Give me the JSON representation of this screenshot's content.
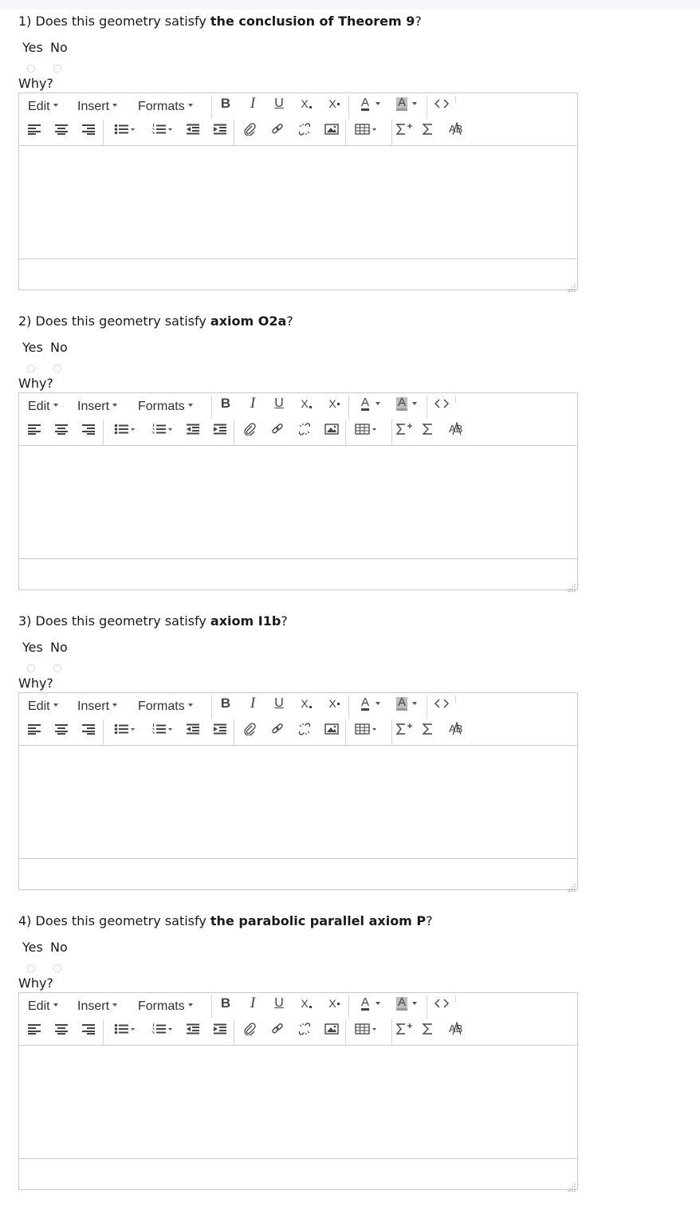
{
  "questions": [
    {
      "num": "1) ",
      "pre": "Does this geometry satisfy ",
      "bold": "the conclusion of Theorem 9",
      "post": "?"
    },
    {
      "num": "2) ",
      "pre": "Does this geometry satisfy ",
      "bold": "axiom O2a",
      "post": "?"
    },
    {
      "num": "3) ",
      "pre": "Does this geometry satisfy ",
      "bold": "axiom I1b",
      "post": "?"
    },
    {
      "num": "4) ",
      "pre": "Does this geometry satisfy ",
      "bold": "the parabolic parallel axiom P",
      "post": "?"
    }
  ],
  "options": {
    "yes": "Yes",
    "no": "No"
  },
  "why_label": "Why?",
  "editor": {
    "menus": {
      "edit": "Edit",
      "insert": "Insert",
      "formats": "Formats"
    },
    "buttons": {
      "bold": "B",
      "italic": "I",
      "underline": "U",
      "subscript": "X",
      "superscript": "X",
      "text_color": "A",
      "bg_color": "A"
    },
    "icons": [
      "bold-icon",
      "italic-icon",
      "underline-icon",
      "subscript-icon",
      "superscript-icon",
      "text-color-icon",
      "background-color-icon",
      "source-code-icon",
      "align-left-icon",
      "align-center-icon",
      "align-right-icon",
      "bullet-list-icon",
      "numbered-list-icon",
      "outdent-icon",
      "indent-icon",
      "attachment-icon",
      "link-icon",
      "unlink-icon",
      "image-icon",
      "table-icon",
      "equation-editor-icon",
      "sigma-icon",
      "spellcheck-icon",
      "resize-grip-icon"
    ]
  }
}
